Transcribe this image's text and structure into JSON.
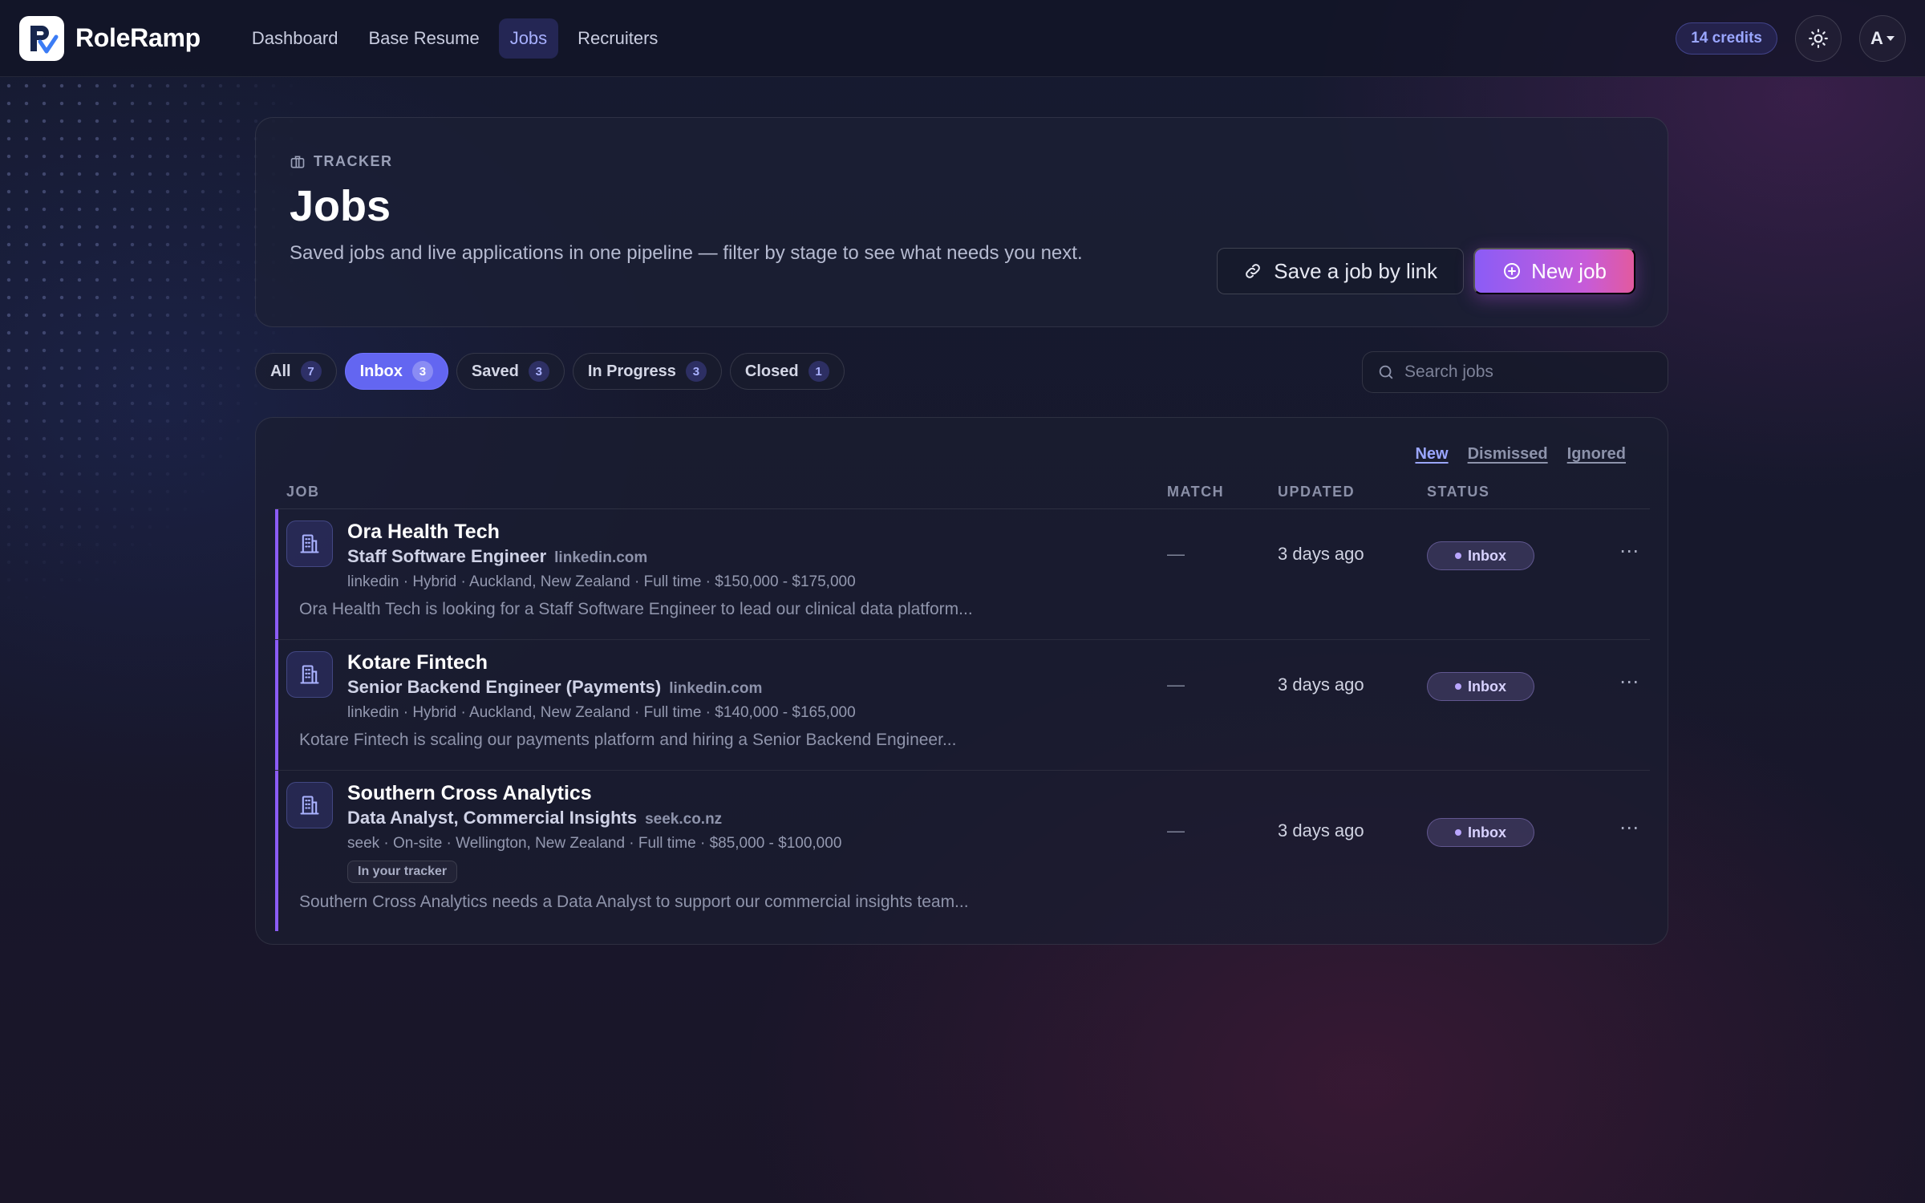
{
  "app": {
    "brand": "RoleRamp",
    "nav": [
      {
        "label": "Dashboard"
      },
      {
        "label": "Base Resume"
      },
      {
        "label": "Jobs"
      },
      {
        "label": "Recruiters"
      }
    ],
    "credits": "14 credits",
    "avatar_initial": "A"
  },
  "hero": {
    "eyebrow": "TRACKER",
    "title": "Jobs",
    "subtitle": "Saved jobs and live applications in one pipeline — filter by stage to see what needs you next.",
    "save_link_label": "Save a job by link",
    "new_job_label": "New job"
  },
  "filters": [
    {
      "label": "All",
      "count": "7"
    },
    {
      "label": "Inbox",
      "count": "3"
    },
    {
      "label": "Saved",
      "count": "3"
    },
    {
      "label": "In Progress",
      "count": "3"
    },
    {
      "label": "Closed",
      "count": "1"
    }
  ],
  "search": {
    "placeholder": "Search jobs"
  },
  "subfilters": [
    "New",
    "Dismissed",
    "Ignored"
  ],
  "table": {
    "columns": {
      "job": "JOB",
      "match": "MATCH",
      "updated": "UPDATED",
      "status": "STATUS"
    },
    "rows": [
      {
        "company": "Ora Health Tech",
        "role": "Staff Software Engineer",
        "source": "linkedin.com",
        "meta": "linkedin · Hybrid · Auckland, New Zealand · Full time · $150,000 - $175,000",
        "tag": "",
        "description": "Ora Health Tech is looking for a Staff Software Engineer to lead our clinical data platform...",
        "match": "—",
        "updated": "3 days ago",
        "status": "Inbox"
      },
      {
        "company": "Kotare Fintech",
        "role": "Senior Backend Engineer (Payments)",
        "source": "linkedin.com",
        "meta": "linkedin · Hybrid · Auckland, New Zealand · Full time · $140,000 - $165,000",
        "tag": "",
        "description": "Kotare Fintech is scaling our payments platform and hiring a Senior Backend Engineer...",
        "match": "—",
        "updated": "3 days ago",
        "status": "Inbox"
      },
      {
        "company": "Southern Cross Analytics",
        "role": "Data Analyst, Commercial Insights",
        "source": "seek.co.nz",
        "meta": "seek · On-site · Wellington, New Zealand · Full time · $85,000 - $100,000",
        "tag": "In your tracker",
        "description": "Southern Cross Analytics needs a Data Analyst to support our commercial insights team...",
        "match": "—",
        "updated": "3 days ago",
        "status": "Inbox"
      }
    ]
  },
  "colors": {
    "accent": "#6366f1",
    "primary_gradient_start": "#8b5cf6",
    "primary_gradient_end": "#e25a9f",
    "background": "#15172b"
  }
}
